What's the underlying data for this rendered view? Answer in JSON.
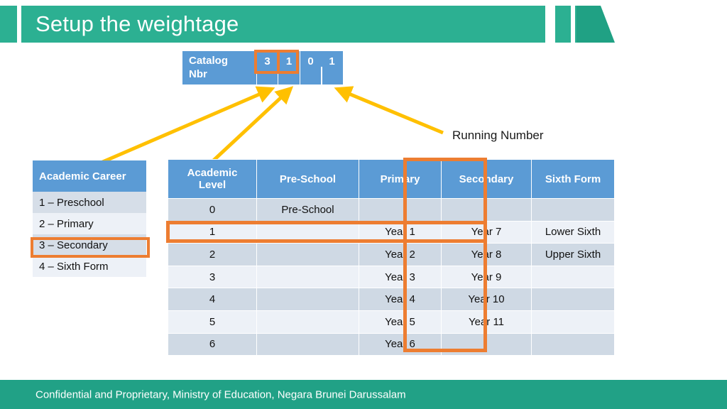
{
  "slide": {
    "title": "Setup the weightage",
    "theme": {
      "teal": "#2CB092",
      "teal_dark": "#21A186",
      "table_blue": "#5B9BD5",
      "highlight_orange": "#ED7D31",
      "arrow_yellow": "#FFC000",
      "row_dark": "#CFD9E4",
      "row_light": "#EDF1F7"
    }
  },
  "catalog": {
    "label_line1": "Catalog",
    "label_line2": "Nbr",
    "digits": [
      "3",
      "1",
      "0",
      "1"
    ],
    "highlighted_digits": [
      "3",
      "1"
    ]
  },
  "annotations": {
    "running_number": "Running Number"
  },
  "career_table": {
    "header": "Academic Career",
    "rows": [
      "1 – Preschool",
      "2 – Primary",
      "3 – Secondary",
      "4 – Sixth Form"
    ],
    "highlighted_row": "3 – Secondary"
  },
  "level_table": {
    "headers": [
      "Academic Level",
      "Pre-School",
      "Primary",
      "Secondary",
      "Sixth Form"
    ],
    "header_level_line1": "Academic",
    "header_level_line2": "Level",
    "rows": [
      {
        "level": "0",
        "pre_school": "Pre-School",
        "primary": "",
        "secondary": "",
        "sixth_form": ""
      },
      {
        "level": "1",
        "pre_school": "",
        "primary": "Year 1",
        "secondary": "Year 7",
        "sixth_form": "Lower Sixth"
      },
      {
        "level": "2",
        "pre_school": "",
        "primary": "Year 2",
        "secondary": "Year 8",
        "sixth_form": "Upper Sixth"
      },
      {
        "level": "3",
        "pre_school": "",
        "primary": "Year 3",
        "secondary": "Year 9",
        "sixth_form": ""
      },
      {
        "level": "4",
        "pre_school": "",
        "primary": "Year 4",
        "secondary": "Year 10",
        "sixth_form": ""
      },
      {
        "level": "5",
        "pre_school": "",
        "primary": "Year 5",
        "secondary": "Year 11",
        "sixth_form": ""
      },
      {
        "level": "6",
        "pre_school": "",
        "primary": "Year 6",
        "secondary": "",
        "sixth_form": ""
      }
    ],
    "highlighted_column": "Secondary",
    "highlighted_row_level": "1"
  },
  "footer": {
    "text": "Confidential and Proprietary, Ministry of Education, Negara Brunei Darussalam"
  }
}
